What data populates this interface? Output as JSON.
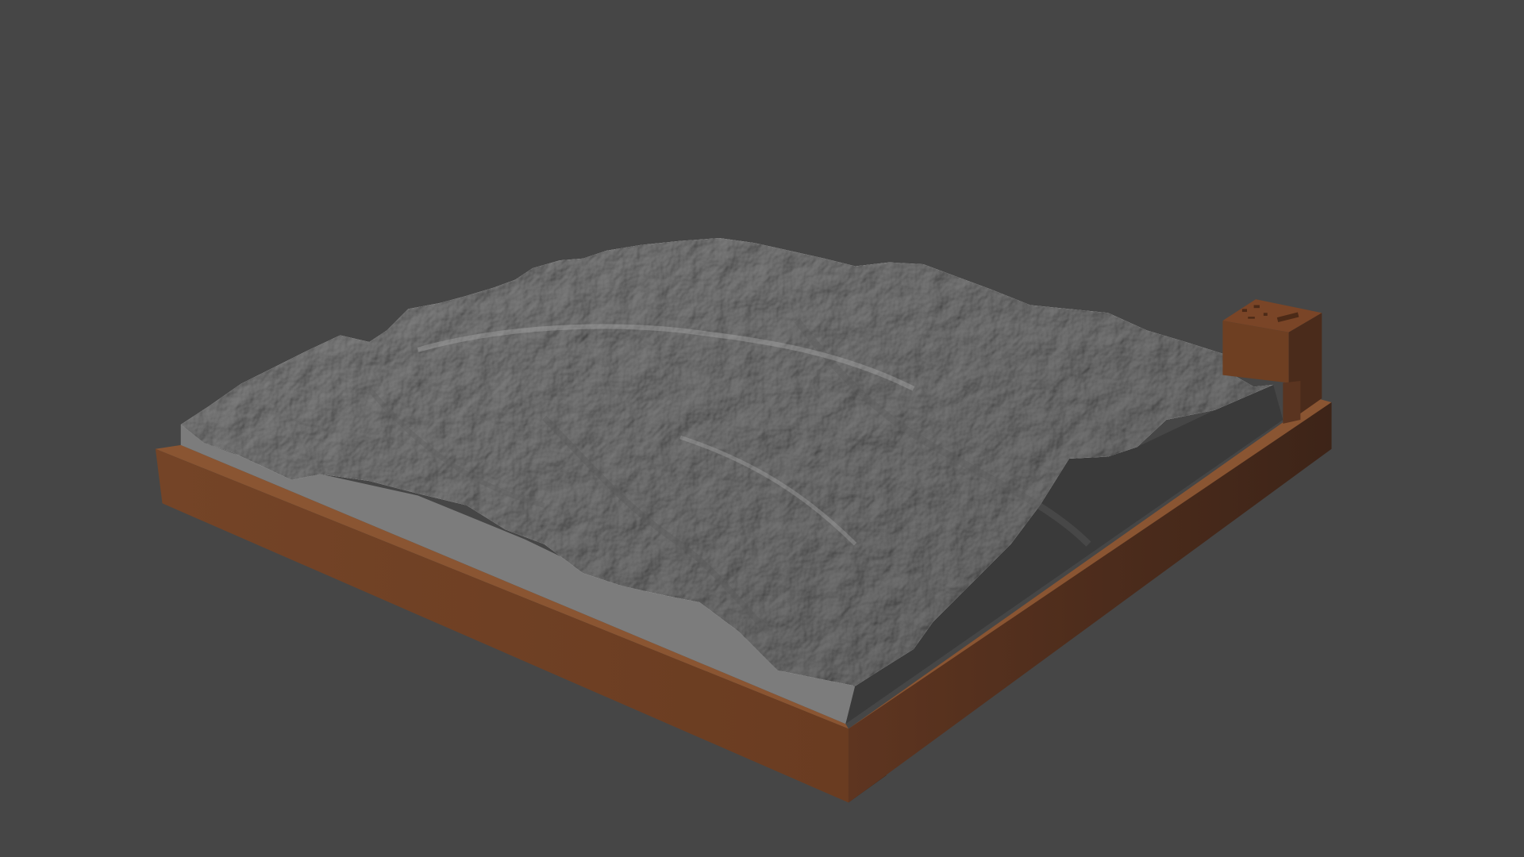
{
  "viewport": {
    "background_color": "#464646"
  },
  "model": {
    "terrain_color": "#8c8c8c",
    "terrain_side_color": "#7b7b7b",
    "base_frame_color": "#6e3f22",
    "base_frame_shadow_color": "#3e2519",
    "placard_color": "#6b3d22"
  }
}
